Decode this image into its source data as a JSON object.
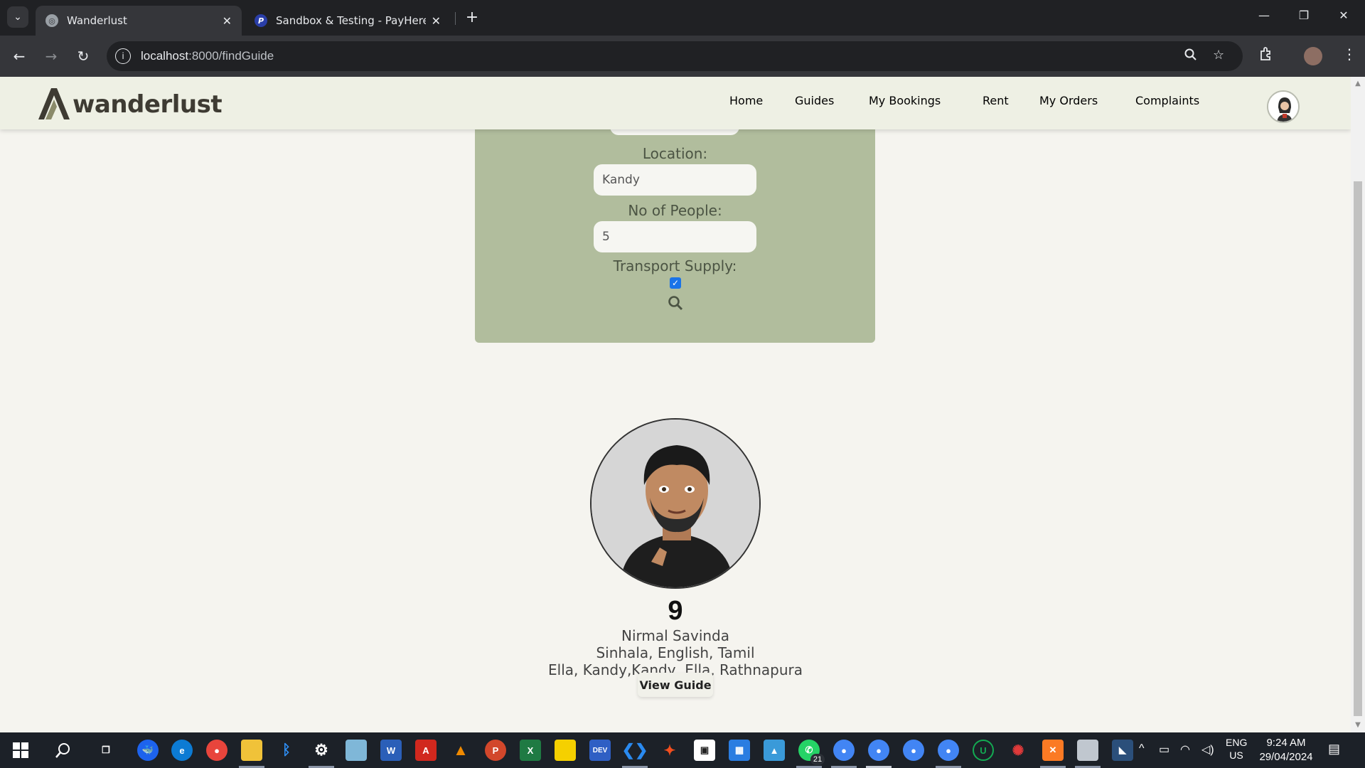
{
  "browser": {
    "tabs": [
      {
        "title": "Wanderlust",
        "active": true
      },
      {
        "title": "Sandbox & Testing - PayHere -",
        "active": false
      }
    ],
    "url_host": "localhost",
    "url_path": ":8000/findGuide",
    "icons": [
      "tab-list-icon",
      "close-icon",
      "new-tab-icon",
      "minimize-icon",
      "restore-icon",
      "window-close-icon",
      "back-icon",
      "forward-icon",
      "reload-icon",
      "site-info-icon",
      "zoom-icon",
      "bookmark-star-icon",
      "extensions-icon",
      "profile-avatar",
      "menu-icon"
    ]
  },
  "site": {
    "logo_text": "wanderlust",
    "nav": [
      "Home",
      "Guides",
      "My Bookings",
      "Rent",
      "My Orders",
      "Complaints"
    ]
  },
  "search_form": {
    "location_label": "Location:",
    "location_value": "Kandy",
    "people_label": "No of People:",
    "people_value": "5",
    "transport_label": "Transport Supply:",
    "transport_checked": true
  },
  "guide": {
    "id": "9",
    "name": "Nirmal Savinda",
    "languages": "Sinhala, English, Tamil",
    "areas": "Ella, Kandy,Kandy, Ella, Rathnapura",
    "button": "View Guide"
  },
  "taskbar": {
    "whatsapp_badge": "21",
    "lang_line1": "ENG",
    "lang_line2": "US",
    "time": "9:24 AM",
    "date": "29/04/2024"
  },
  "colors": {
    "panel": "#b1bd9d",
    "nav_text": "#4a5a32",
    "header_bg": "#eef0e4",
    "page_bg": "#f5f4ef"
  }
}
